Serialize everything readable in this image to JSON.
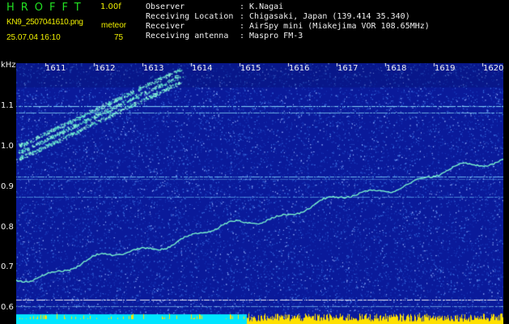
{
  "app": {
    "logo": "HROFFT",
    "version": "1.00f",
    "filename": "KN9_2507041610.png",
    "datetime": "25.07.04 16:10",
    "meteor_label": "meteor",
    "meteor_count": "75"
  },
  "info": [
    {
      "label": "Observer",
      "value": ": K.Nagai"
    },
    {
      "label": "Receiving Location",
      "value": ": Chigasaki, Japan (139.414 35.340)"
    },
    {
      "label": "Receiver",
      "value": ": AirSpy mini (Miakejima VOR 108.65MHz)"
    },
    {
      "label": "Receiving antenna",
      "value": ": Maspro FM-3"
    }
  ],
  "spectrogram": {
    "y_unit": "kHz",
    "y_ticks": [
      "1.1",
      "1.0",
      "0.9",
      "0.8",
      "0.7",
      "0.6"
    ],
    "x_ticks": [
      "1611",
      "1612",
      "1613",
      "1614",
      "1615",
      "1616",
      "1617",
      "1618",
      "1619",
      "1620"
    ],
    "colors": {
      "background": "#0a1a9a",
      "noise": "#3a6fe0",
      "signal": "#7fffd0",
      "bottom_bar": "#00e5ff",
      "bottom_bar_peaks": "#ffe000",
      "text_green": "#22e022",
      "text_yellow": "#f0f000"
    }
  }
}
